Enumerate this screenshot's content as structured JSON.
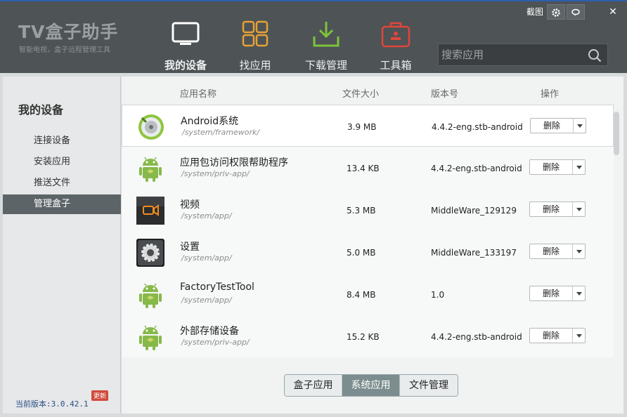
{
  "app": {
    "logo": "TV盒子助手",
    "slogan": "智能电视，盒子远程管理工具"
  },
  "window": {
    "screenshot_label": "截图",
    "settings_icon": "gear-icon",
    "feedback_icon": "chat-icon",
    "close_label": "✕"
  },
  "nav": [
    {
      "label": "我的设备",
      "icon": "monitor-icon",
      "active": true
    },
    {
      "label": "找应用",
      "icon": "grid-icon"
    },
    {
      "label": "下载管理",
      "icon": "download-icon"
    },
    {
      "label": "工具箱",
      "icon": "toolbox-icon"
    }
  ],
  "search": {
    "placeholder": "搜索应用",
    "icon": "search-icon"
  },
  "sidebar": {
    "title": "我的设备",
    "items": [
      {
        "label": "连接设备"
      },
      {
        "label": "安装应用"
      },
      {
        "label": "推送文件"
      },
      {
        "label": "管理盒子",
        "active": true
      }
    ],
    "version": "当前版本:3.0.42.1",
    "update_badge": "更新"
  },
  "table": {
    "columns": [
      "应用名称",
      "文件大小",
      "版本号",
      "操作"
    ],
    "rows": [
      {
        "name": "Android系统",
        "path": "/system/framework/",
        "size": "3.9 MB",
        "version": "4.4.2-eng.stb-android",
        "action": "删除",
        "icon": "android-system-icon"
      },
      {
        "name": "应用包访问权限帮助程序",
        "path": "/system/priv-app/",
        "size": "13.4 KB",
        "version": "4.4.2-eng.stb-android",
        "action": "删除",
        "icon": "android-robot-icon"
      },
      {
        "name": "视频",
        "path": "/system/app/",
        "size": "5.3 MB",
        "version": "MiddleWare_129129",
        "action": "删除",
        "icon": "video-icon"
      },
      {
        "name": "设置",
        "path": "/system/app/",
        "size": "5.0 MB",
        "version": "MiddleWare_133197",
        "action": "删除",
        "icon": "settings-gear-icon"
      },
      {
        "name": "FactoryTestTool",
        "path": "/system/app/",
        "size": "8.4 MB",
        "version": "1.0",
        "action": "删除",
        "icon": "android-robot-icon"
      },
      {
        "name": "外部存储设备",
        "path": "/system/priv-app/",
        "size": "15.2 KB",
        "version": "4.4.2-eng.stb-android",
        "action": "删除",
        "icon": "android-robot-icon"
      }
    ]
  },
  "tabs": [
    {
      "label": "盒子应用"
    },
    {
      "label": "系统应用",
      "active": true
    },
    {
      "label": "文件管理"
    }
  ],
  "colors": {
    "header_bg": "#4e5355",
    "accent_orange": "#e8a233",
    "accent_green": "#7cc43a",
    "accent_red": "#e0453c",
    "android_green": "#86b94a"
  }
}
